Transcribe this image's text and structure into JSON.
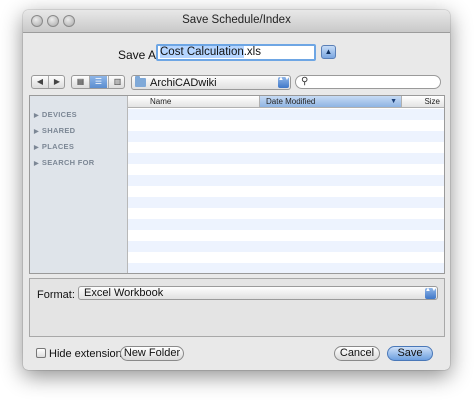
{
  "window": {
    "title": "Save Schedule/Index"
  },
  "save_as": {
    "label": "Save As:",
    "value_selected": "Cost Calculation",
    "value_ext": ".xls",
    "expand_glyph": "▲"
  },
  "toolbar": {
    "back_glyph": "◀",
    "forward_glyph": "▶",
    "view_icons": "▦",
    "view_list": "☰",
    "view_columns": "▥",
    "location": "ArchiCADwiki",
    "popup_glyph": "▲▼",
    "search_glyph": "🔍",
    "search_placeholder": ""
  },
  "sidebar": {
    "sections": [
      {
        "label": "DEVICES"
      },
      {
        "label": "SHARED"
      },
      {
        "label": "PLACES"
      },
      {
        "label": "SEARCH FOR"
      }
    ],
    "triangle": "▶"
  },
  "columns": [
    {
      "label": "Name"
    },
    {
      "label": "Date Modified",
      "sort_glyph": "▼"
    },
    {
      "label": "Size"
    }
  ],
  "format": {
    "label": "Format:",
    "value": "Excel Workbook"
  },
  "footer": {
    "hide_extension_label": "Hide extension",
    "new_folder_label": "New Folder",
    "cancel_label": "Cancel",
    "save_label": "Save"
  }
}
